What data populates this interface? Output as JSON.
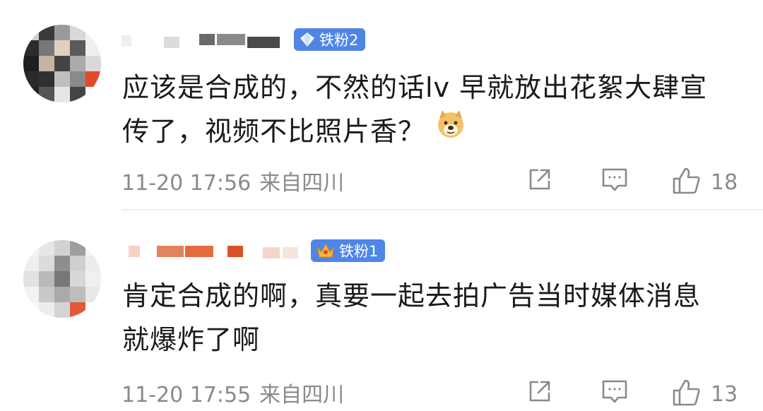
{
  "comments": [
    {
      "badge": "铁粉2",
      "badge_icon": "diamond-icon",
      "text_line1": "应该是合成的，不然的话lv 早就放出花絮大肆宣",
      "text_line2": "传了，视频不比照片香？",
      "emoji": "doge-emoji-icon",
      "time": "11-20 17:56",
      "location": "来自四川",
      "likes": "18"
    },
    {
      "badge": "铁粉1",
      "badge_icon": "crown-icon",
      "text_line1": "肯定合成的啊，真要一起去拍广告当时媒体消息",
      "text_line2": "就爆炸了啊",
      "time": "11-20 17:55",
      "location": "来自四川",
      "likes": "13"
    }
  ],
  "colors": {
    "badge_bg": "#4f86e6",
    "text": "#1a1a1a",
    "meta": "#8a8a8a",
    "divider": "#ececec"
  }
}
